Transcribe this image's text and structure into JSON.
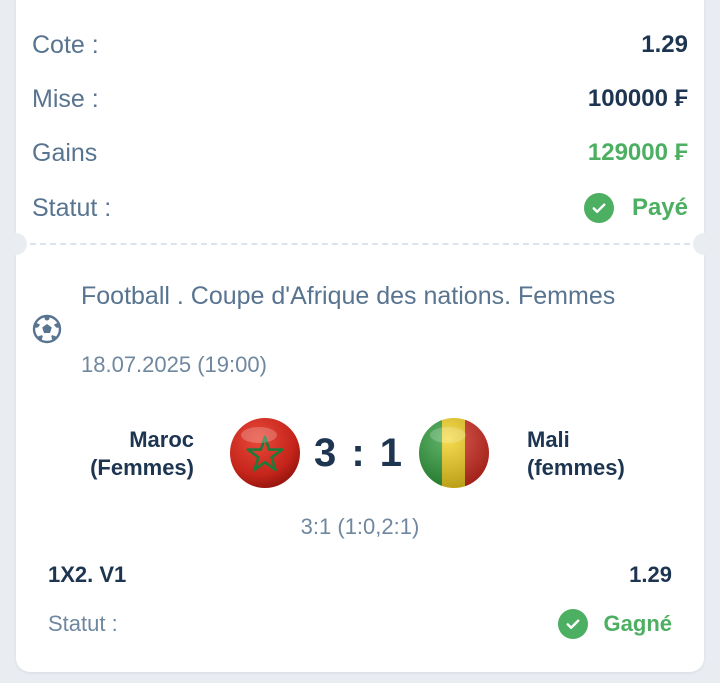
{
  "summary": {
    "rows": [
      {
        "label": "Cote :",
        "value": "1.29"
      },
      {
        "label": "Mise :",
        "value": "100000 ₣"
      },
      {
        "label": "Gains",
        "value": "129000 ₣"
      },
      {
        "label": "Statut :",
        "value": "Payé"
      }
    ]
  },
  "event": {
    "title": "Football . Coupe d'Afrique des nations. Femmes",
    "date": "18.07.2025 (19:00)",
    "home_team": "Maroc (Femmes)",
    "away_team": "Mali (femmes)",
    "score": "3 : 1",
    "detail_score": "3:1 (1:0,2:1)",
    "icon": "soccer-ball-icon"
  },
  "bet": {
    "market": "1X2. V1",
    "odds": "1.29",
    "status_label": "Statut :",
    "status_value": "Gagné"
  },
  "colors": {
    "accent_green": "#4caf61",
    "text_dark": "#1d3550",
    "text_muted": "#587490",
    "background": "#e9edf2"
  }
}
